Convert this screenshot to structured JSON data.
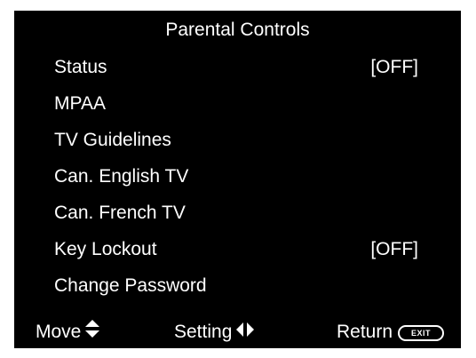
{
  "title": "Parental Controls",
  "menu": {
    "items": [
      {
        "label": "Status",
        "value": "[OFF]"
      },
      {
        "label": "MPAA",
        "value": ""
      },
      {
        "label": "TV Guidelines",
        "value": ""
      },
      {
        "label": "Can. English TV",
        "value": ""
      },
      {
        "label": "Can. French TV",
        "value": ""
      },
      {
        "label": "Key Lockout",
        "value": "[OFF]"
      },
      {
        "label": "Change Password",
        "value": ""
      }
    ]
  },
  "footer": {
    "move_label": "Move",
    "move_icon": "up-down-arrows-icon",
    "setting_label": "Setting",
    "setting_icon": "left-right-arrows-icon",
    "return_label": "Return",
    "return_icon": "exit-button-icon",
    "exit_text": "EXIT"
  },
  "colors": {
    "background": "#000000",
    "text": "#ffffff"
  }
}
